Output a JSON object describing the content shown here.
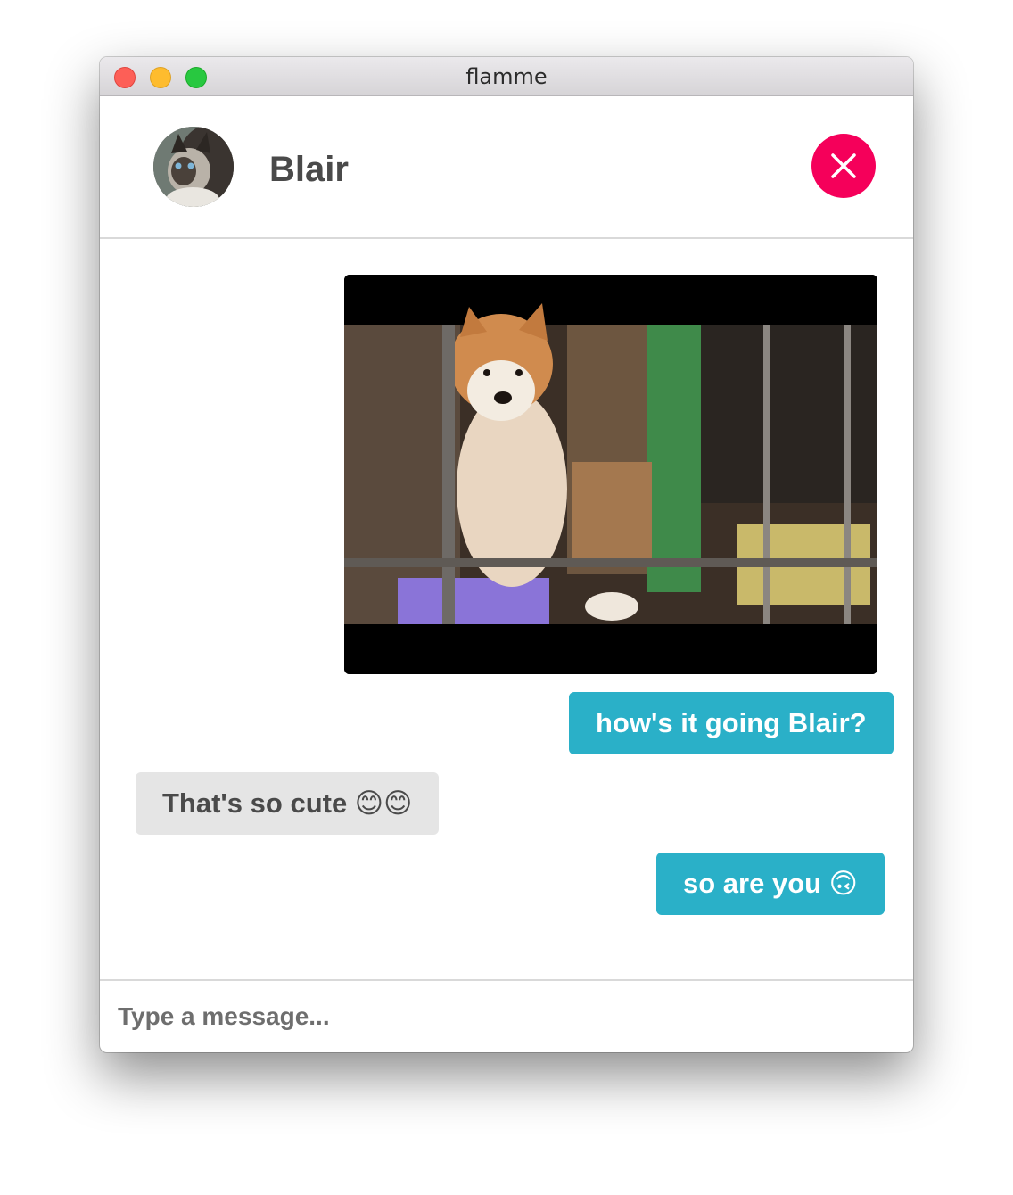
{
  "window": {
    "title": "flamme"
  },
  "header": {
    "contact_name": "Blair",
    "close_icon": "close-icon"
  },
  "colors": {
    "accent": "#f5005a",
    "outgoing": "#2ab0c8",
    "incoming": "#e5e5e5"
  },
  "messages": [
    {
      "from": "me",
      "type": "gif"
    },
    {
      "from": "me",
      "type": "text",
      "text": "how's it going Blair?"
    },
    {
      "from": "them",
      "type": "text",
      "text": "That's so cute 😊😊"
    },
    {
      "from": "me",
      "type": "text",
      "text": "so are you 🙃"
    }
  ],
  "composer": {
    "placeholder": "Type a message...",
    "value": ""
  }
}
